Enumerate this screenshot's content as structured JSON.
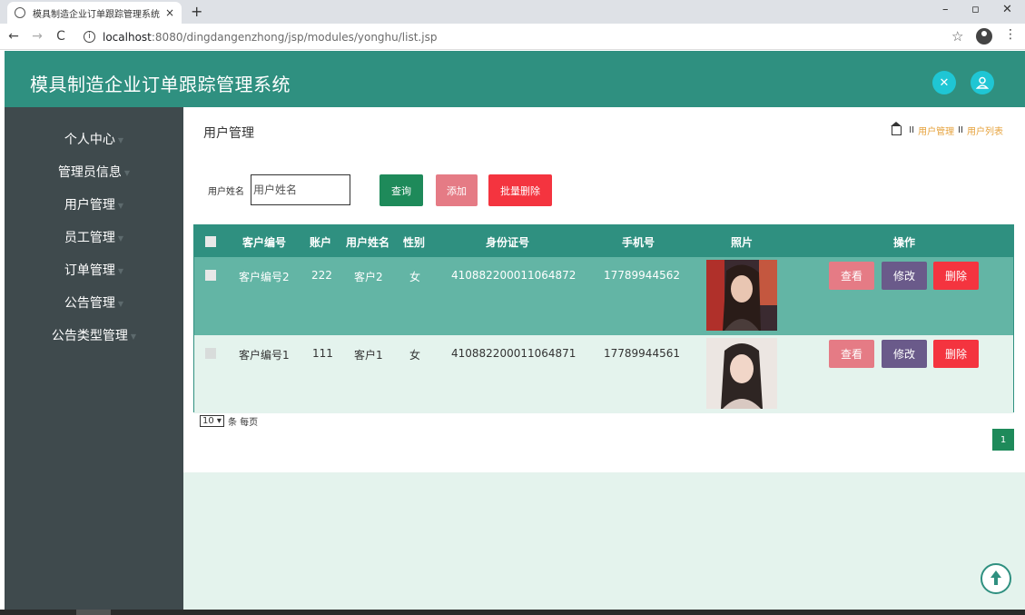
{
  "browser": {
    "tab_title": "模具制造企业订单跟踪管理系统",
    "tab_close": "×",
    "new_tab": "+",
    "url_host": "localhost",
    "url_path": ":8080/dingdangenzhong/jsp/modules/yonghu/list.jsp",
    "window_controls": [
      "–",
      "▫",
      "✕"
    ]
  },
  "header": {
    "title": "模具制造企业订单跟踪管理系统"
  },
  "sidebar": {
    "items": [
      {
        "label": "个人中心"
      },
      {
        "label": "管理员信息"
      },
      {
        "label": "用户管理"
      },
      {
        "label": "员工管理"
      },
      {
        "label": "订单管理"
      },
      {
        "label": "公告管理"
      },
      {
        "label": "公告类型管理"
      }
    ]
  },
  "page": {
    "title": "用户管理",
    "breadcrumb": [
      "用户管理",
      "用户列表"
    ],
    "breadcrumb_sep": "II"
  },
  "search": {
    "label": "用户姓名",
    "placeholder": "用户姓名",
    "value": ""
  },
  "buttons": {
    "query": "查询",
    "add": "添加",
    "batch_delete": "批量删除"
  },
  "table": {
    "columns": [
      "客户编号",
      "账户",
      "用户姓名",
      "性别",
      "身份证号",
      "手机号",
      "照片",
      "操作"
    ],
    "rows": [
      {
        "customer_no": "客户编号2",
        "account": "222",
        "name": "客户2",
        "gender": "女",
        "id_card": "410882200011064872",
        "phone": "17789944562"
      },
      {
        "customer_no": "客户编号1",
        "account": "111",
        "name": "客户1",
        "gender": "女",
        "id_card": "410882200011064871",
        "phone": "17789944561"
      }
    ],
    "actions": {
      "view": "查看",
      "edit": "修改",
      "delete": "删除"
    }
  },
  "pagination": {
    "page_size": "10",
    "page_size_suffix": "条 每页",
    "current_page": "1"
  },
  "colors": {
    "primary": "#2f9080",
    "sidebar": "#3f4a4d",
    "row_selected": "#63b5a5",
    "row_alt": "#e4f3ed",
    "btn_query": "#1e8a5a",
    "btn_add": "#e57b85",
    "btn_delete": "#f4343f",
    "btn_edit": "#6a5a8a",
    "header_icon": "#1fc6d4"
  },
  "icons": [
    "fullscreen-icon",
    "user-icon",
    "home-icon",
    "back-to-top-icon"
  ]
}
